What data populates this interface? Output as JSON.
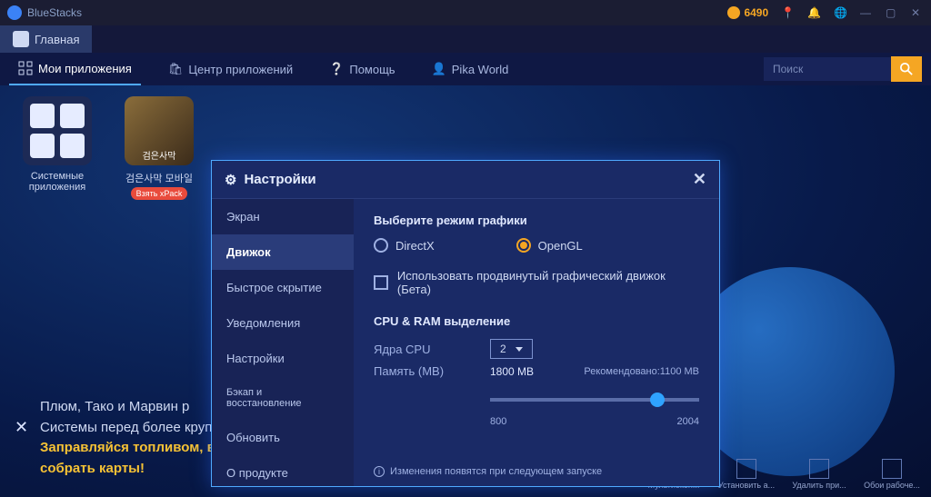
{
  "titlebar": {
    "app_name": "BlueStacks",
    "main_tab": "Главная",
    "coins": "6490"
  },
  "nav": {
    "my_apps": "Мои приложения",
    "app_center": "Центр приложений",
    "help": "Помощь",
    "pika": "Pika World",
    "search_placeholder": "Поиск"
  },
  "apps": {
    "system": "Системные приложения",
    "game": "검은사막 모바일",
    "badge": "Взять xPack"
  },
  "promo": {
    "line1": "Плюм, Тако и Марвин р",
    "line2": "Системы перед более крупными приключениями!",
    "line3": "Заправляйся топливом, выполняя задания, и посещай планеты чтобы",
    "line4": "собрать карты!"
  },
  "tray": {
    "t1": "Мультиокон...",
    "t2": "Установить a...",
    "t3": "Удалить при...",
    "t4": "Обои рабоче..."
  },
  "settings": {
    "title": "Настройки",
    "tabs": {
      "screen": "Экран",
      "engine": "Движок",
      "boss": "Быстрое скрытие",
      "notifications": "Уведомления",
      "prefs": "Настройки",
      "backup": "Бэкап и восстановление",
      "update": "Обновить",
      "about": "О продукте"
    },
    "graphics_mode_label": "Выберите режим графики",
    "radio_directx": "DirectX",
    "radio_opengl": "OpenGL",
    "advanced_engine": "Использовать продвинутый графический движок (Бета)",
    "cpu_ram_header": "CPU & RAM выделение",
    "cpu_cores_label": "Ядра CPU",
    "cpu_cores_value": "2",
    "memory_label": "Память (MB)",
    "memory_value": "1800 MB",
    "recommended": "Рекомендовано:1100 MB",
    "slider_min": "800",
    "slider_max": "2004",
    "restart_note": "Изменения появятся при следующем запуске"
  }
}
